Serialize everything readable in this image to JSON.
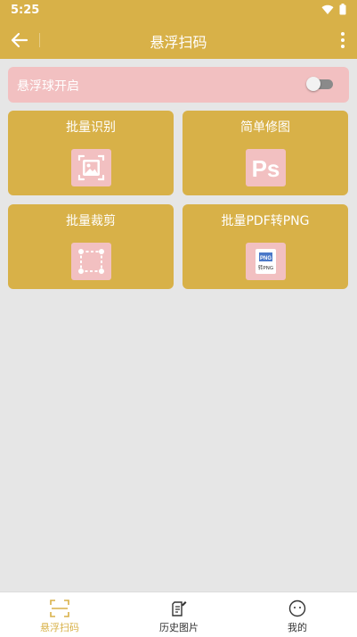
{
  "status_bar": {
    "time": "5:25"
  },
  "app_bar": {
    "title": "悬浮扫码"
  },
  "floating_ball": {
    "label": "悬浮球开启",
    "enabled": false
  },
  "cards": [
    {
      "label": "批量识别",
      "icon": "image-scan-icon"
    },
    {
      "label": "简单修图",
      "icon": "ps-icon",
      "icon_text": "Ps"
    },
    {
      "label": "批量裁剪",
      "icon": "crop-icon"
    },
    {
      "label": "批量PDF转PNG",
      "icon": "pdf-to-png-icon",
      "icon_text": "转PNG",
      "icon_badge": "PNG"
    }
  ],
  "bottom_nav": [
    {
      "label": "悬浮扫码",
      "icon": "scan-frame-icon",
      "active": true
    },
    {
      "label": "历史图片",
      "icon": "history-doc-icon",
      "active": false
    },
    {
      "label": "我的",
      "icon": "smiley-icon",
      "active": false
    }
  ],
  "colors": {
    "primary": "#d8b148",
    "pink": "#f2c0c1",
    "background": "#e6e6e6",
    "nav_active": "#d8b148",
    "nav_inactive": "#333333"
  }
}
